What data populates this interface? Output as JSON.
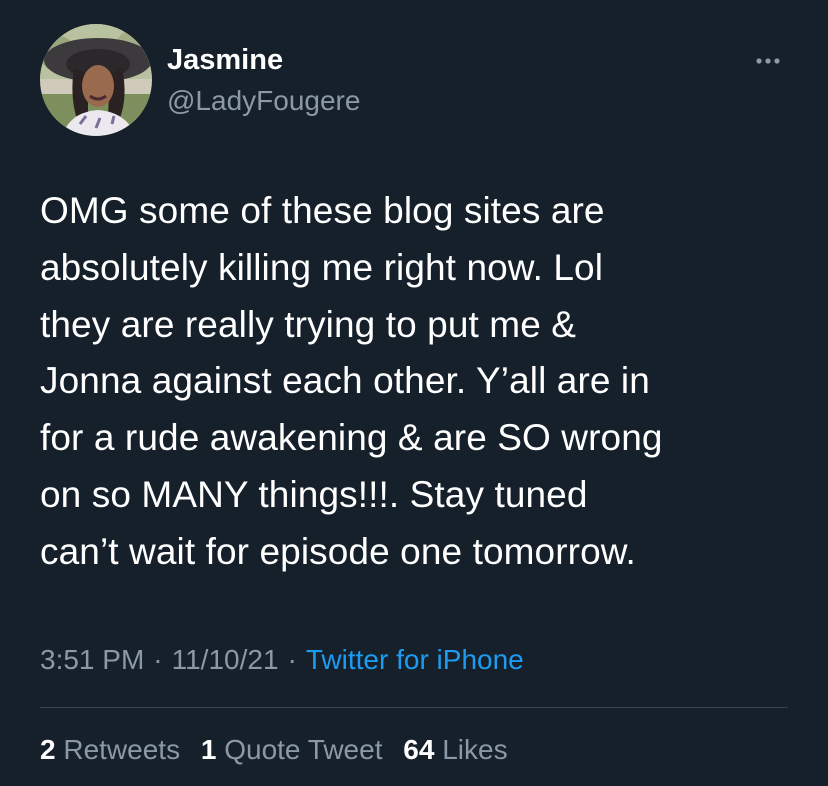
{
  "tweet": {
    "author": {
      "display_name": "Jasmine",
      "handle": "@LadyFougere"
    },
    "more_icon": "more-horizontal-icon",
    "text_lines": [
      "OMG some of these blog sites are",
      "absolutely killing me right now. Lol",
      "they are really trying to put me &",
      "Jonna against each other. Y’all are in",
      "for a rude awakening & are SO wrong",
      "on so MANY things!!!. Stay tuned",
      "can’t wait for episode one tomorrow."
    ],
    "time": "3:51 PM",
    "separator": "·",
    "date": "11/10/21",
    "source": "Twitter for iPhone",
    "stats": {
      "retweets_count": "2",
      "retweets_label": "Retweets",
      "quotes_count": "1",
      "quotes_label": "Quote Tweet",
      "likes_count": "64",
      "likes_label": "Likes"
    }
  },
  "colors": {
    "background": "#15202b",
    "primary_text": "#ffffff",
    "secondary_text": "#8b98a5",
    "link": "#1d9bf0",
    "divider": "#38444d"
  }
}
